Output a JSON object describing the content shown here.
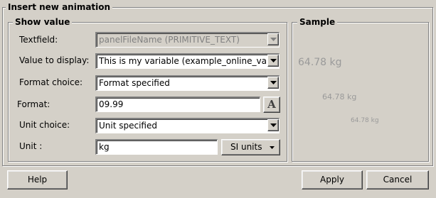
{
  "dialog": {
    "title": "Insert new animation"
  },
  "show_value": {
    "title": "Show value",
    "textfield": {
      "label": "Textfield:",
      "value": "panelFileName (PRIMITIVE_TEXT)"
    },
    "value_to_display": {
      "label": "Value to display:",
      "value": "This is my variable (example_online_value)"
    },
    "format_choice": {
      "label": "Format choice:",
      "value": "Format specified"
    },
    "format": {
      "label": "Format:",
      "value": "09.99",
      "button_glyph": "A",
      "button_icon": "font-icon"
    },
    "unit_choice": {
      "label": "Unit choice:",
      "value": "Unit specified"
    },
    "unit": {
      "label": "Unit :",
      "value": "kg",
      "units_button": "SI units"
    }
  },
  "sample": {
    "title": "Sample",
    "large": "64.78 kg",
    "medium": "64.78 kg",
    "small": "64.78 kg"
  },
  "buttons": {
    "help": "Help",
    "apply": "Apply",
    "cancel": "Cancel"
  },
  "colors": {
    "dialog_bg": "#d4d0c8",
    "field_bg": "#ffffff",
    "sample_text": "#9a9a9a",
    "disabled_text": "#808080"
  }
}
